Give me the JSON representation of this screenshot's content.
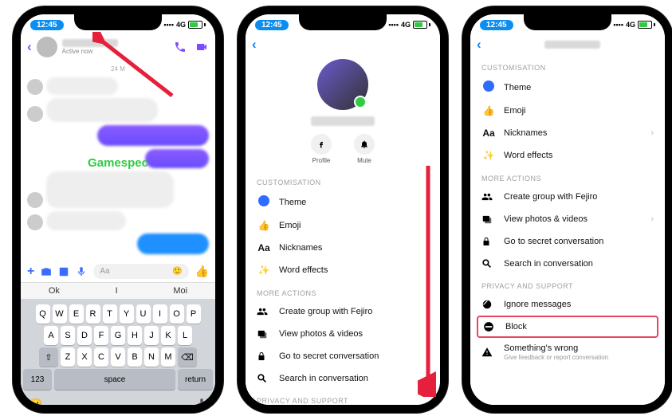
{
  "statusbar": {
    "time": "12:45",
    "net": "4G"
  },
  "chat": {
    "status": "Active now",
    "date": "24 M",
    "watermark": "Gamespec",
    "composer": {
      "placeholder": "Aa"
    },
    "suggest": [
      "Ok",
      "I",
      "Moi"
    ],
    "keyboard": {
      "row1": [
        "Q",
        "W",
        "E",
        "R",
        "T",
        "Y",
        "U",
        "I",
        "O",
        "P"
      ],
      "row2": [
        "A",
        "S",
        "D",
        "F",
        "G",
        "H",
        "J",
        "K",
        "L"
      ],
      "row3": [
        "Z",
        "X",
        "C",
        "V",
        "B",
        "N",
        "M"
      ],
      "num": "123",
      "space": "space",
      "ret": "return"
    }
  },
  "quick": {
    "profile": "Profile",
    "mute": "Mute"
  },
  "sections": {
    "custom": "CUSTOMISATION",
    "more": "MORE ACTIONS",
    "priv": "PRIVACY AND SUPPORT"
  },
  "items": {
    "theme": "Theme",
    "emoji": "Emoji",
    "nick": "Nicknames",
    "word": "Word effects",
    "group": "Create group with Fejiro",
    "photos": "View photos & videos",
    "secret": "Go to secret conversation",
    "search": "Search in conversation",
    "ignore": "Ignore messages",
    "block": "Block",
    "wrong": "Something's wrong",
    "wrong_sub": "Give feedback or report conversation"
  },
  "colors": {
    "purple": "#7b4cff",
    "blue": "#0a84ff",
    "highlight": "#e9455f"
  }
}
